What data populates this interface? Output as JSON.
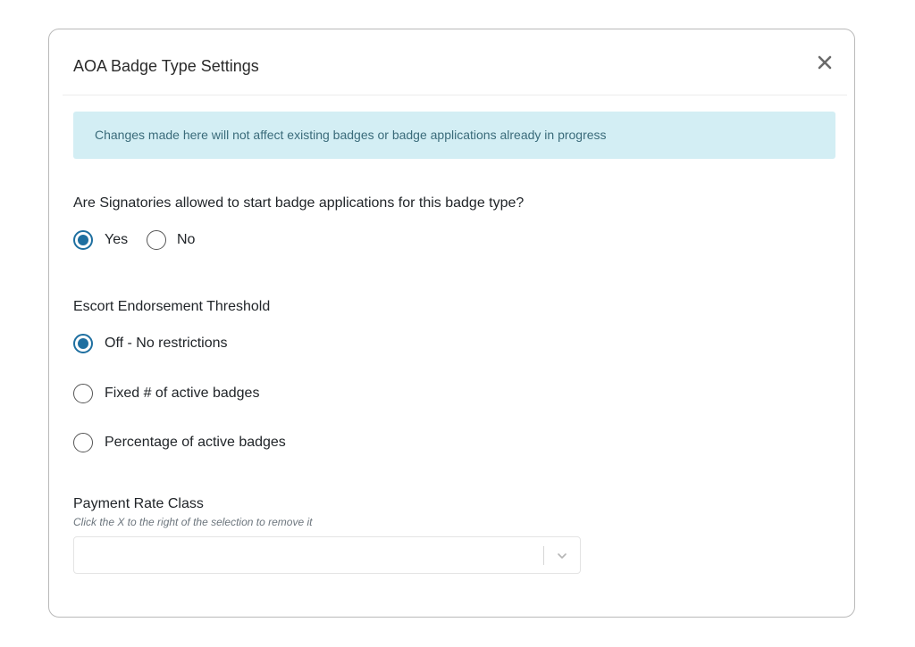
{
  "modal": {
    "title": "AOA Badge Type Settings",
    "close_icon": "close-icon"
  },
  "alert": {
    "text": "Changes made here will not affect existing badges or badge applications already in progress"
  },
  "signatories": {
    "question": "Are Signatories allowed to start badge applications for this badge type?",
    "options": [
      {
        "label": "Yes",
        "checked": true
      },
      {
        "label": "No",
        "checked": false
      }
    ]
  },
  "escort": {
    "question": "Escort Endorsement Threshold",
    "options": [
      {
        "label": "Off - No restrictions",
        "checked": true
      },
      {
        "label": "Fixed # of active badges",
        "checked": false
      },
      {
        "label": "Percentage of active badges",
        "checked": false
      }
    ]
  },
  "payment": {
    "label": "Payment Rate Class",
    "hint": "Click the X to the right of the selection to remove it",
    "selected_value": "",
    "chevron_icon": "chevron-down-icon"
  },
  "colors": {
    "accent": "#1e6fa0",
    "alert_bg": "#d3eef4",
    "alert_text": "#3a6b7a"
  }
}
